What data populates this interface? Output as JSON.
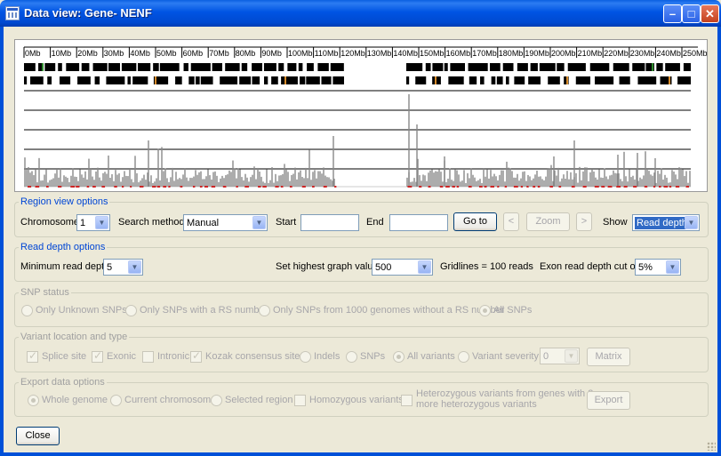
{
  "window": {
    "title": "Data view: Gene- NENF"
  },
  "graph": {
    "axis_labels": [
      "0Mb",
      "10Mb",
      "20Mb",
      "30Mb",
      "40Mb",
      "50Mb",
      "60Mb",
      "70Mb",
      "80Mb",
      "90Mb",
      "100Mb",
      "110Mb",
      "120Mb",
      "130Mb",
      "140Mb",
      "150Mb",
      "160Mb",
      "170Mb",
      "180Mb",
      "190Mb",
      "200Mb",
      "210Mb",
      "220Mb",
      "230Mb",
      "240Mb",
      "250Mb"
    ]
  },
  "region": {
    "legend": "Region view options",
    "chromosome_label": "Chromosome",
    "chromosome_value": "1",
    "search_label": "Search method",
    "search_value": "Manual",
    "start_label": "Start",
    "start_value": "",
    "end_label": "End",
    "end_value": "",
    "goto_label": "Go to",
    "prev_label": "<",
    "zoom_label": "Zoom",
    "next_label": ">",
    "show_label": "Show",
    "show_value": "Read depth"
  },
  "readdepth": {
    "legend": "Read depth options",
    "min_label": "Minimum read depth",
    "min_value": "5",
    "highest_label": "Set highest graph value",
    "highest_value": "500",
    "gridlines_text": "Gridlines = 100 reads",
    "cutoff_label": "Exon read depth cut off",
    "cutoff_value": "5%"
  },
  "snp": {
    "legend": "SNP status",
    "options": [
      "Only Unknown SNPs",
      "Only SNPs with a RS number",
      "Only SNPs from 1000 genomes without a RS number",
      "All SNPs"
    ],
    "selected": "All SNPs"
  },
  "variant": {
    "legend": "Variant location and type",
    "checks": [
      {
        "label": "Splice site",
        "checked": true
      },
      {
        "label": "Exonic",
        "checked": true
      },
      {
        "label": "Intronic",
        "checked": false
      },
      {
        "label": "Kozak consensus site",
        "checked": true
      }
    ],
    "radios": [
      "Indels",
      "SNPs",
      "All variants",
      "Variant severity"
    ],
    "selected": "All variants",
    "severity_value": "0",
    "matrix_label": "Matrix"
  },
  "export": {
    "legend": "Export data options",
    "radios": [
      "Whole genome",
      "Current chromosome",
      "Selected region"
    ],
    "selected": "Whole genome",
    "homo_label": "Homozygous variants",
    "hetero_label_1": "Heterozygous variants from genes with 2 or",
    "hetero_label_2": "more heterozygous variants",
    "export_label": "Export"
  },
  "close_label": "Close",
  "colors": {
    "accent": "#0046d5",
    "title_bar": "#0054e3",
    "depth_bars": "#888888",
    "exon_marks": "#e00000"
  }
}
